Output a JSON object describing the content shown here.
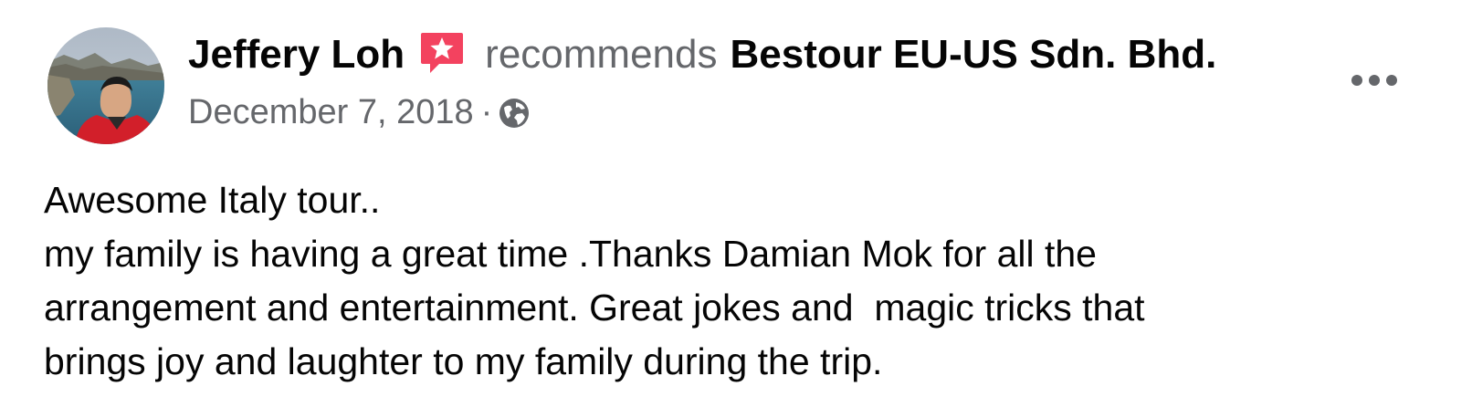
{
  "post": {
    "author": "Jeffery Loh",
    "recommends": "recommends",
    "page": "Bestour EU-US Sdn. Bhd.",
    "date": "December 7, 2018",
    "separator": "·",
    "audience_icon": "globe-icon",
    "recommendation_icon": "recommendation-star-icon",
    "more_icon": "more-options-icon",
    "lines": [
      "Awesome Italy tour..",
      "my family is having a great time .Thanks Damian Mok for all the",
      "arrangement and entertainment. Great jokes and  magic tricks that",
      "brings joy and laughter to my family during the trip."
    ]
  },
  "colors": {
    "text_primary": "#050505",
    "text_secondary": "#65676b",
    "recommend_badge": "#f3425f"
  }
}
